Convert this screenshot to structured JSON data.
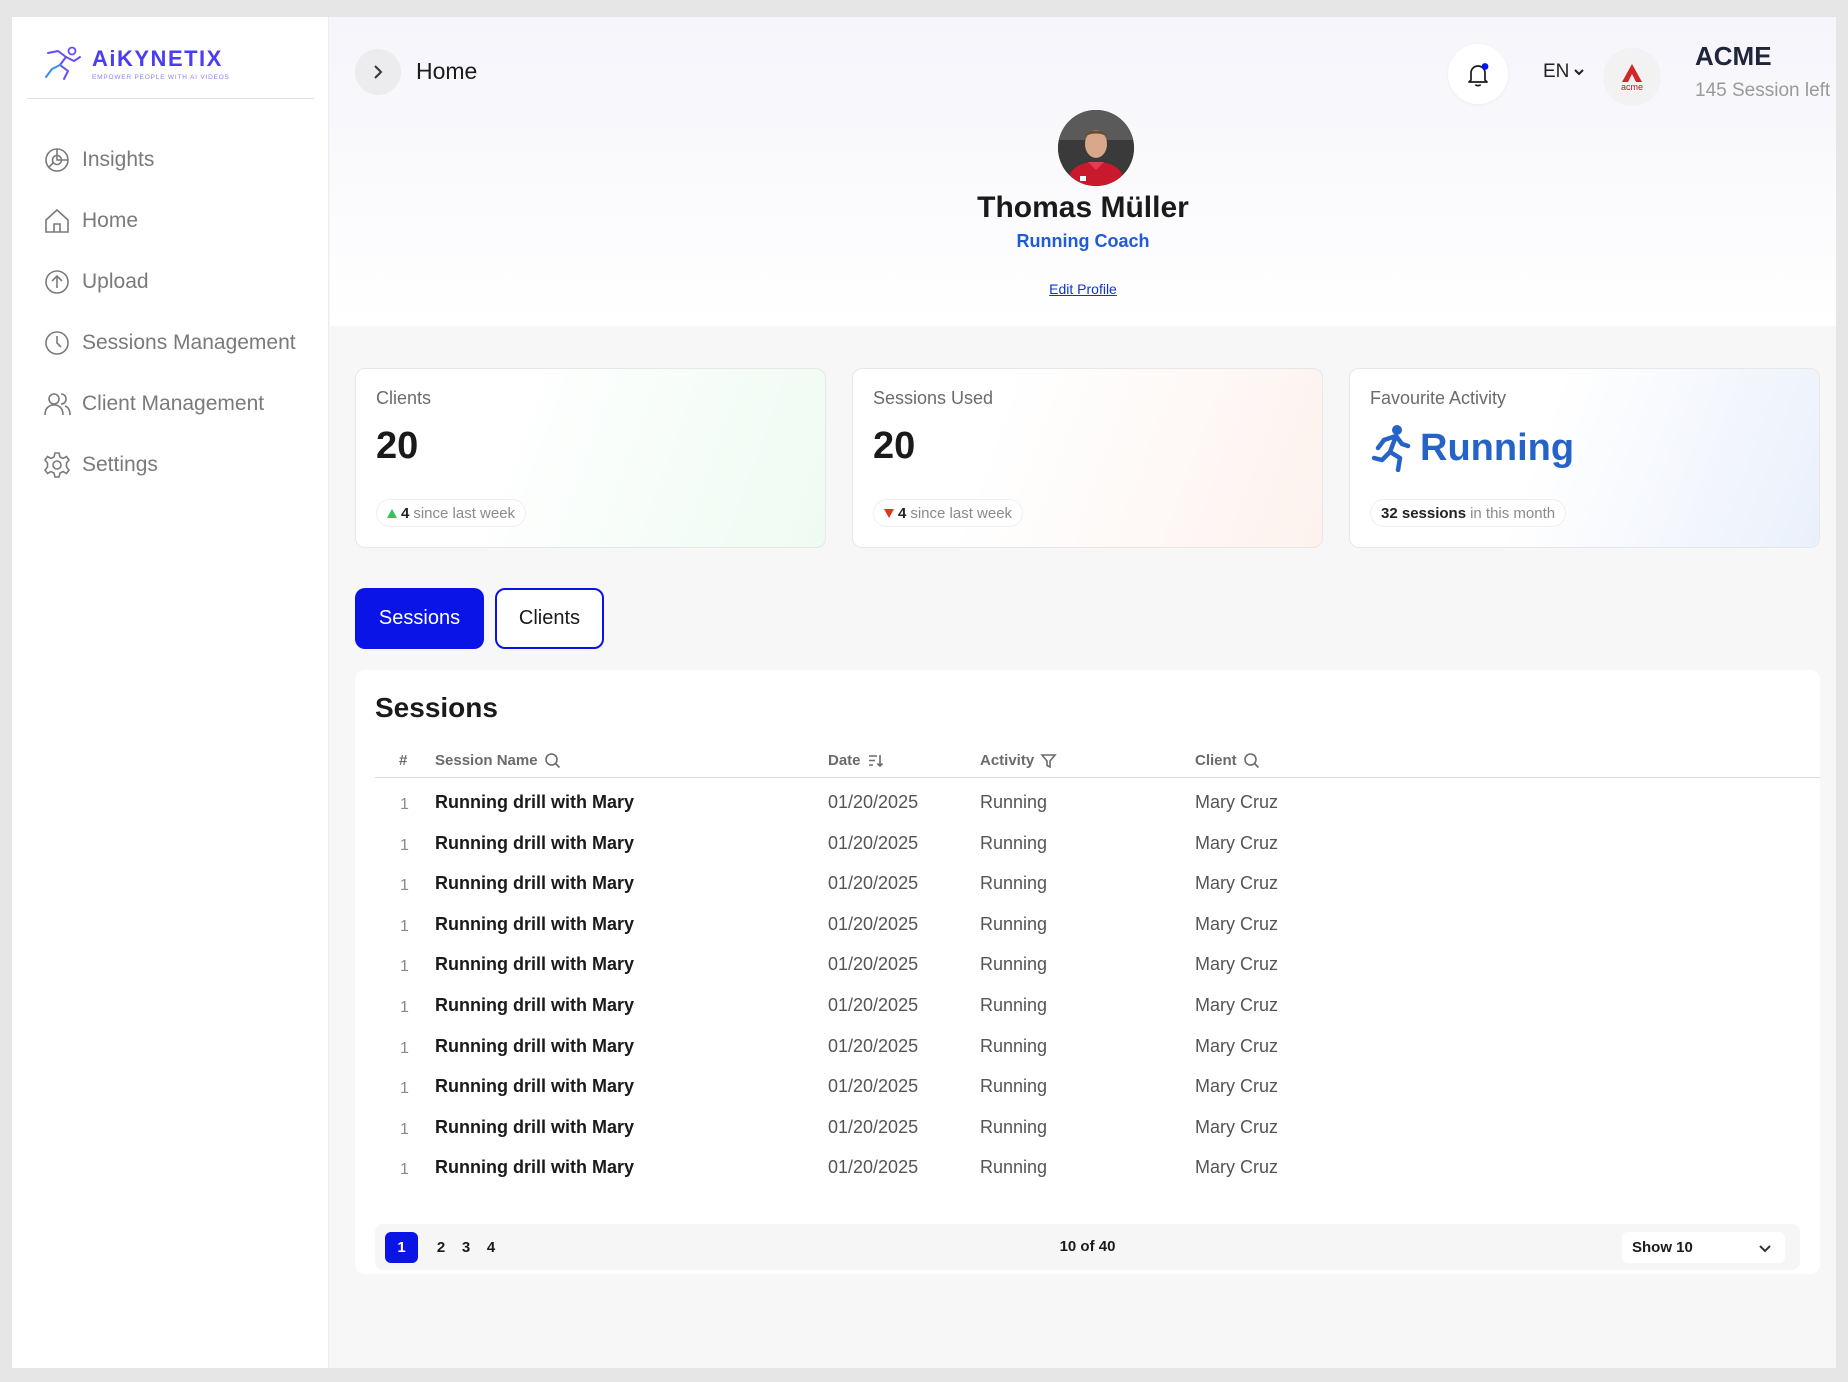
{
  "brand": {
    "name": "AiKYNETIX",
    "tagline": "EMPOWER PEOPLE WITH AI VIDEOS",
    "accent": "#4b3ef0"
  },
  "sidebar": {
    "items": [
      {
        "label": "Insights",
        "icon": "insights-icon"
      },
      {
        "label": "Home",
        "icon": "home-icon"
      },
      {
        "label": "Upload",
        "icon": "upload-icon"
      },
      {
        "label": "Sessions Management",
        "icon": "clock-icon"
      },
      {
        "label": "Client Management",
        "icon": "users-icon"
      },
      {
        "label": "Settings",
        "icon": "gear-icon"
      }
    ]
  },
  "header": {
    "breadcrumb": "Home",
    "language": "EN",
    "org_name": "ACME",
    "org_logo_text": "acme",
    "sessions_left": "145 Session left"
  },
  "profile": {
    "name": "Thomas Müller",
    "role": "Running Coach",
    "edit_label": "Edit Profile"
  },
  "stats": {
    "clients": {
      "title": "Clients",
      "value": "20",
      "delta": "4",
      "delta_text": "since last week",
      "trend": "up"
    },
    "sessions_used": {
      "title": "Sessions Used",
      "value": "20",
      "delta": "4",
      "delta_text": "since last week",
      "trend": "down"
    },
    "favourite": {
      "title": "Favourite Activity",
      "value": "Running",
      "count": "32 sessions",
      "count_text": "in this month"
    }
  },
  "tabs": [
    {
      "label": "Sessions",
      "active": true
    },
    {
      "label": "Clients",
      "active": false
    }
  ],
  "sessions_table": {
    "title": "Sessions",
    "columns": {
      "num": "#",
      "name": "Session Name",
      "date": "Date",
      "activity": "Activity",
      "client": "Client"
    },
    "rows": [
      {
        "num": "1",
        "name": "Running drill with Mary",
        "date": "01/20/2025",
        "activity": "Running",
        "client": "Mary Cruz"
      },
      {
        "num": "1",
        "name": "Running drill with Mary",
        "date": "01/20/2025",
        "activity": "Running",
        "client": "Mary Cruz"
      },
      {
        "num": "1",
        "name": "Running drill with Mary",
        "date": "01/20/2025",
        "activity": "Running",
        "client": "Mary Cruz"
      },
      {
        "num": "1",
        "name": "Running drill with Mary",
        "date": "01/20/2025",
        "activity": "Running",
        "client": "Mary Cruz"
      },
      {
        "num": "1",
        "name": "Running drill with Mary",
        "date": "01/20/2025",
        "activity": "Running",
        "client": "Mary Cruz"
      },
      {
        "num": "1",
        "name": "Running drill with Mary",
        "date": "01/20/2025",
        "activity": "Running",
        "client": "Mary Cruz"
      },
      {
        "num": "1",
        "name": "Running drill with Mary",
        "date": "01/20/2025",
        "activity": "Running",
        "client": "Mary Cruz"
      },
      {
        "num": "1",
        "name": "Running drill with Mary",
        "date": "01/20/2025",
        "activity": "Running",
        "client": "Mary Cruz"
      },
      {
        "num": "1",
        "name": "Running drill with Mary",
        "date": "01/20/2025",
        "activity": "Running",
        "client": "Mary Cruz"
      },
      {
        "num": "1",
        "name": "Running drill with Mary",
        "date": "01/20/2025",
        "activity": "Running",
        "client": "Mary Cruz"
      }
    ],
    "pagination": {
      "pages": [
        "1",
        "2",
        "3",
        "4"
      ],
      "current": "1",
      "count_label": "10 of 40",
      "show_label": "Show 10"
    }
  },
  "colors": {
    "primary": "#0a14e6",
    "link": "#1f5bd6",
    "trend_up": "#3bbf5a",
    "trend_down": "#e0341c"
  }
}
